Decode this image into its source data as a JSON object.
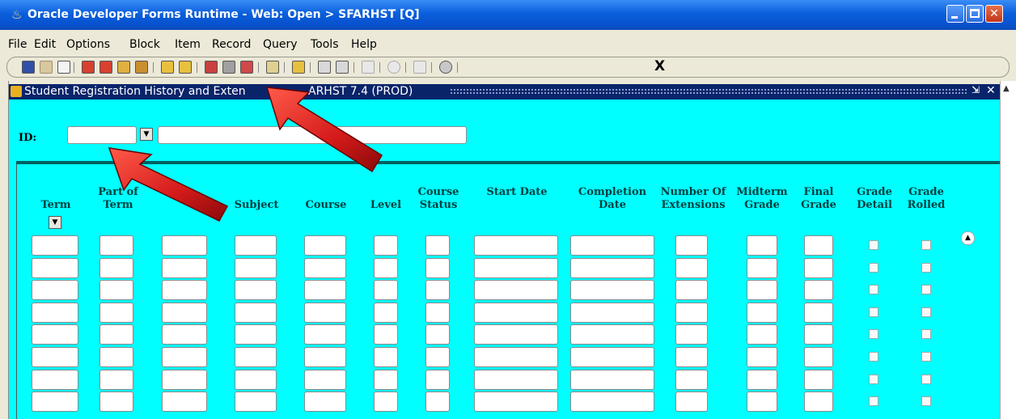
{
  "window": {
    "title": "Oracle Developer Forms Runtime - Web:  Open > SFARHST [Q]",
    "icon": "java-cup-icon"
  },
  "menu": [
    "File",
    "Edit",
    "Options",
    "Block",
    "Item",
    "Record",
    "Query",
    "Tools",
    "Help"
  ],
  "toolbar": {
    "exit_label": "X"
  },
  "form": {
    "title_left": "Student Registration History and Exten",
    "title_right": "ARHST  7.4  (PROD)",
    "id_label": "ID:",
    "id_value": "",
    "name_value": ""
  },
  "columns": [
    {
      "label": "Term",
      "lov": true
    },
    {
      "label": "Part of Term",
      "lov": false
    },
    {
      "label": "",
      "lov": false
    },
    {
      "label": "Subject",
      "lov": false
    },
    {
      "label": "Course",
      "lov": false
    },
    {
      "label": "Level",
      "lov": false
    },
    {
      "label": "Course Status",
      "lov": false
    },
    {
      "label": "Start Date",
      "lov": false
    },
    {
      "label": "Completion Date",
      "lov": false
    },
    {
      "label": "Number Of Extensions",
      "lov": false
    },
    {
      "label": "Midterm Grade",
      "lov": false
    },
    {
      "label": "Final Grade",
      "lov": false
    },
    {
      "label": "Grade Detail",
      "lov": false
    },
    {
      "label": "Grade Rolled",
      "lov": false
    }
  ],
  "row_count": 8,
  "colors": {
    "canvas": "#00ffff",
    "title_active": "#0a246a",
    "annotation_arrow": "#d41a1a"
  }
}
